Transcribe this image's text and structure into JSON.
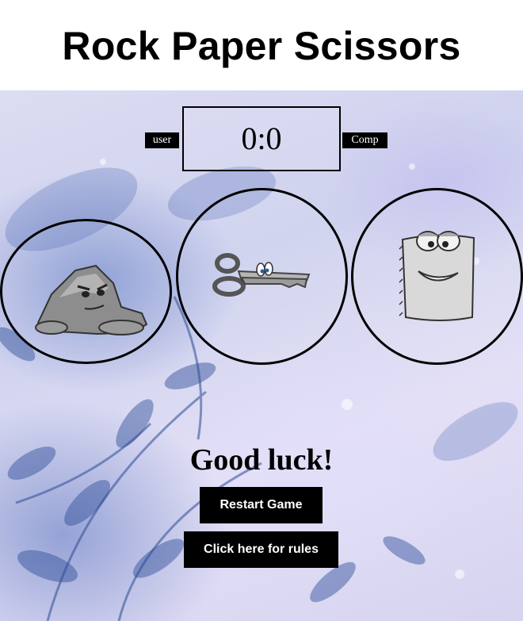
{
  "header": {
    "title": "Rock Paper Scissors"
  },
  "scoreboard": {
    "user_label": "user",
    "score": "0:0",
    "comp_label": "Comp"
  },
  "choices": [
    {
      "id": "rock",
      "icon": "rock-character-icon"
    },
    {
      "id": "scissors",
      "icon": "scissors-character-icon"
    },
    {
      "id": "paper",
      "icon": "paper-character-icon"
    }
  ],
  "result": {
    "message": "Good luck!"
  },
  "buttons": {
    "restart_label": "Restart Game",
    "rules_label": "Click here for rules"
  },
  "colors": {
    "accent": "#000000",
    "button_text": "#ffffff",
    "background_tint": "#d6d3f0"
  }
}
